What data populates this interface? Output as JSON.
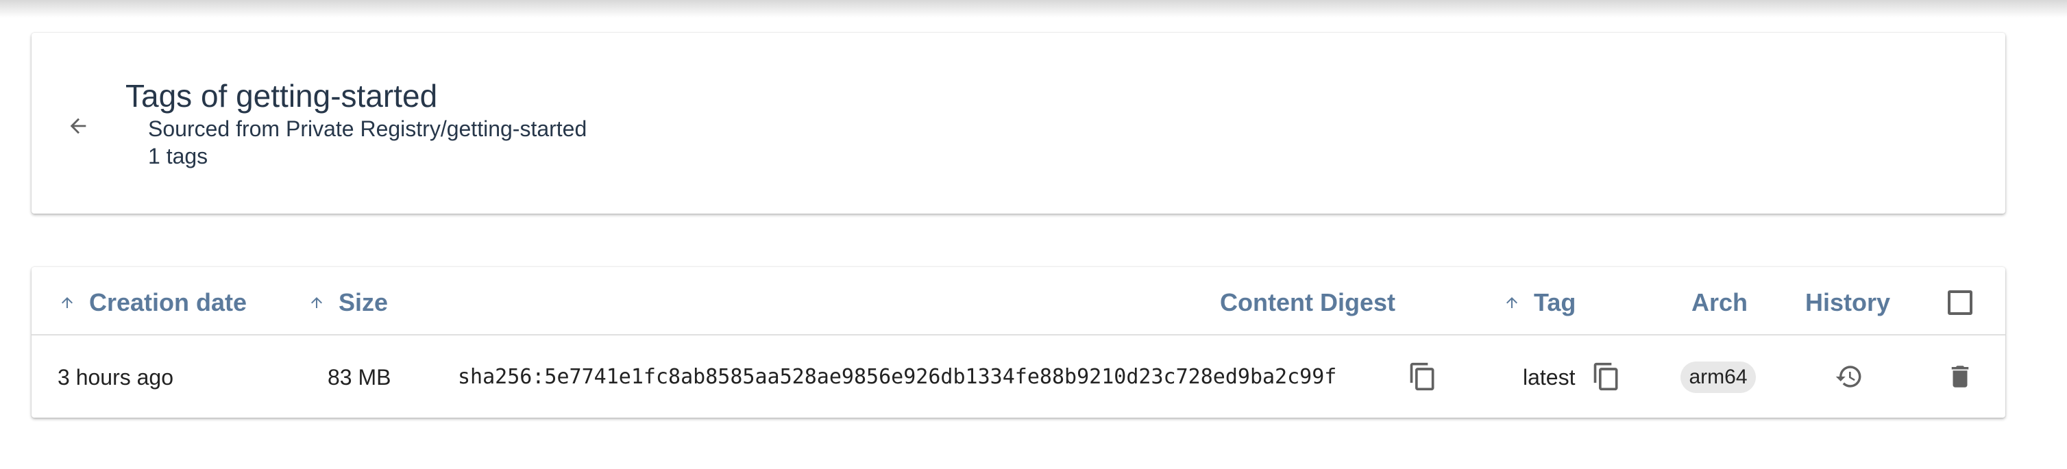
{
  "header": {
    "title": "Tags of getting-started",
    "source": "Sourced from Private Registry/getting-started",
    "tag_count": "1 tags",
    "back_icon": "arrow-left-icon"
  },
  "table": {
    "columns": {
      "creation_date": "Creation date",
      "size": "Size",
      "content_digest": "Content Digest",
      "tag": "Tag",
      "arch": "Arch",
      "history": "History"
    },
    "rows": [
      {
        "creation_date": "3 hours ago",
        "size": "83 MB",
        "digest": "sha256:5e7741e1fc8ab8585aa528ae9856e926db1334fe88b9210d23c728ed9ba2c99f",
        "tag": "latest",
        "arch": "arm64"
      }
    ]
  },
  "icons": {
    "sort": "arrow-up-icon",
    "copy": "copy-icon",
    "history": "history-icon",
    "delete": "trash-icon",
    "select_all": "checkbox-icon"
  },
  "colors": {
    "header_text": "#5b7a9c",
    "title_text": "#27374a",
    "icon": "#616161"
  }
}
